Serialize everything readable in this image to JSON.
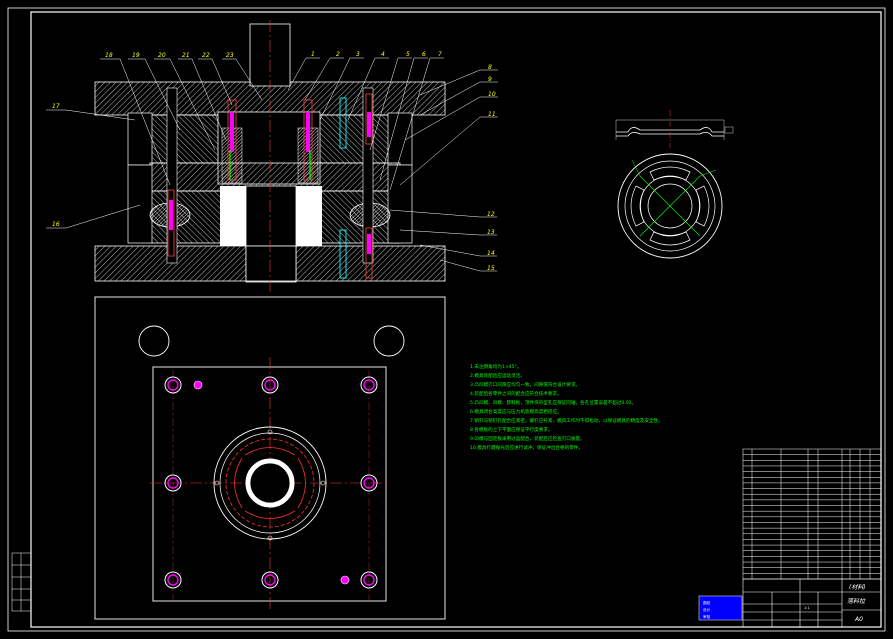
{
  "part_numbers_top": [
    "18",
    "19",
    "20",
    "21",
    "22",
    "23",
    "1",
    "2",
    "3",
    "4",
    "5",
    "6",
    "7"
  ],
  "part_numbers_right": [
    "8",
    "9",
    "10",
    "11",
    "12",
    "13",
    "14",
    "15"
  ],
  "part_numbers_left": [
    "17",
    "16"
  ],
  "technical_notes": [
    "1.未注倒角均为1×45°。",
    "2.模具装配后应运动灵活。",
    "3.凸凹模刃口间隙应均匀一致，间隙值符合设计要求。",
    "4.装配后各零件之间的配合应符合技术要求。",
    "5.凸凹模、凹模、卸料板，顶件块的型孔应保证同轴，各孔位置误差不超过0.02。",
    "6.模具闭合高度应与压力机装模高度相适应。",
    "7.销钉与销钉孔配合应紧密，螺钉应拧紧，模具工作时不得松动，以保证模具的精度及安全性。",
    "8.各模板的上下平面应保证平行度要求。",
    "9.凹模与固定板采用过盈配合，装配后应检查刃口质量。",
    "10.模具打磨抛光后应进行试冲，保证冲出合格的零件。"
  ],
  "title_block": {
    "drawing_name": "落料拉",
    "material": "(材料)",
    "scale": "1:1",
    "sheet": "A0"
  },
  "stamp_lines": [
    "图纸",
    "设计",
    "审核"
  ],
  "colors": {
    "background": "#000000",
    "frame": "#ffffff",
    "part_labels": "#ffff00",
    "notes": "#00ff00",
    "centerline": "#ff0000",
    "spring": "#ff00ff",
    "cyan_parts": "#00ffff",
    "stamp": "#0000ff"
  }
}
